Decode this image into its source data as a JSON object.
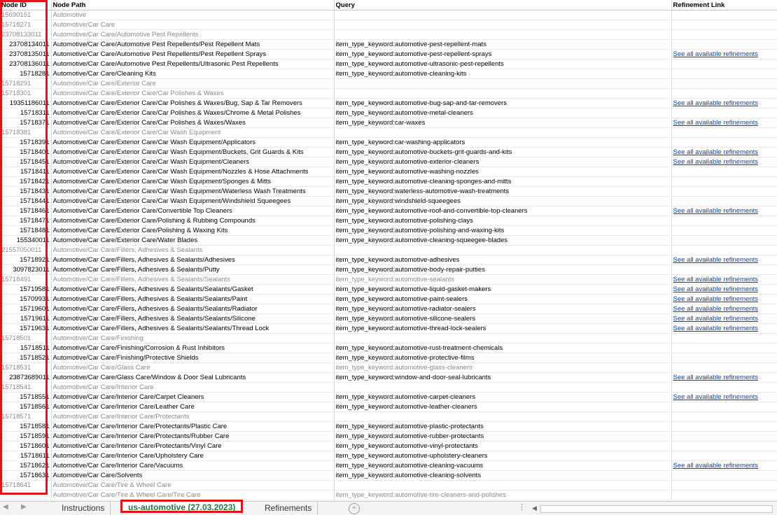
{
  "headers": [
    "Node ID",
    "Node Path",
    "Query",
    "Refinement Link"
  ],
  "rows": [
    {
      "id": "15690151",
      "path": "Automotive",
      "query": "",
      "link": "",
      "gray": true
    },
    {
      "id": "15718271",
      "path": "Automotive/Car Care",
      "query": "",
      "link": "",
      "gray": true
    },
    {
      "id": "23708133011",
      "path": "Automotive/Car Care/Automotive Pest Repellents",
      "query": "",
      "link": "",
      "gray": true
    },
    {
      "id": "23708134011",
      "path": "Automotive/Car Care/Automotive Pest Repellents/Pest Repellent Mats",
      "query": "item_type_keyword:automotive-pest-repellent-mats",
      "link": "",
      "gray": false
    },
    {
      "id": "23708135011",
      "path": "Automotive/Car Care/Automotive Pest Repellents/Pest Repellent Sprays",
      "query": "item_type_keyword:automotive-pest-repellent-sprays",
      "link": "See all available refinements",
      "gray": false
    },
    {
      "id": "23708136011",
      "path": "Automotive/Car Care/Automotive Pest Repellents/Ultrasonic Pest Repellents",
      "query": "item_type_keyword:automotive-ultrasonic-pest-repellents",
      "link": "",
      "gray": false
    },
    {
      "id": "15718281",
      "path": "Automotive/Car Care/Cleaning Kits",
      "query": "item_type_keyword:automotive-cleaning-kits",
      "link": "",
      "gray": false
    },
    {
      "id": "15718291",
      "path": "Automotive/Car Care/Exterior Care",
      "query": "",
      "link": "",
      "gray": true
    },
    {
      "id": "15718301",
      "path": "Automotive/Car Care/Exterior Care/Car Polishes & Waxes",
      "query": "",
      "link": "",
      "gray": true
    },
    {
      "id": "19351186011",
      "path": "Automotive/Car Care/Exterior Care/Car Polishes & Waxes/Bug, Sap & Tar Removers",
      "query": "item_type_keyword:automotive-bug-sap-and-tar-removers",
      "link": "See all available refinements",
      "gray": false
    },
    {
      "id": "15718311",
      "path": "Automotive/Car Care/Exterior Care/Car Polishes & Waxes/Chrome & Metal Polishes",
      "query": "item_type_keyword:automotive-metal-cleaners",
      "link": "",
      "gray": false
    },
    {
      "id": "15718371",
      "path": "Automotive/Car Care/Exterior Care/Car Polishes & Waxes/Waxes",
      "query": "item_type_keyword:car-waxes",
      "link": "See all available refinements",
      "gray": false
    },
    {
      "id": "15718381",
      "path": "Automotive/Car Care/Exterior Care/Car Wash Equipment",
      "query": "",
      "link": "",
      "gray": true
    },
    {
      "id": "15718391",
      "path": "Automotive/Car Care/Exterior Care/Car Wash Equipment/Applicators",
      "query": "item_type_keyword:car-washing-applicators",
      "link": "",
      "gray": false
    },
    {
      "id": "15718401",
      "path": "Automotive/Car Care/Exterior Care/Car Wash Equipment/Buckets, Grit Guards & Kits",
      "query": "item_type_keyword:automotive-buckets-grit-guards-and-kits",
      "link": "See all available refinements",
      "gray": false
    },
    {
      "id": "15718451",
      "path": "Automotive/Car Care/Exterior Care/Car Wash Equipment/Cleaners",
      "query": "item_type_keyword:automotive-exterior-cleaners",
      "link": "See all available refinements",
      "gray": false
    },
    {
      "id": "15718411",
      "path": "Automotive/Car Care/Exterior Care/Car Wash Equipment/Nozzles & Hose Attachments",
      "query": "item_type_keyword:automotive-washing-nozzles",
      "link": "",
      "gray": false
    },
    {
      "id": "15718421",
      "path": "Automotive/Car Care/Exterior Care/Car Wash Equipment/Sponges & Mitts",
      "query": "item_type_keyword:automotive-cleaning-sponges-and-mitts",
      "link": "",
      "gray": false
    },
    {
      "id": "15718431",
      "path": "Automotive/Car Care/Exterior Care/Car Wash Equipment/Waterless Wash Treatments",
      "query": "item_type_keyword:waterless-automotive-wash-treatments",
      "link": "",
      "gray": false
    },
    {
      "id": "15718441",
      "path": "Automotive/Car Care/Exterior Care/Car Wash Equipment/Windshield Squeegees",
      "query": "item_type_keyword:windshield-squeegees",
      "link": "",
      "gray": false
    },
    {
      "id": "15718461",
      "path": "Automotive/Car Care/Exterior Care/Convertible Top Cleaners",
      "query": "item_type_keyword:automotive-roof-and-convertible-top-cleaners",
      "link": "See all available refinements",
      "gray": false
    },
    {
      "id": "15718471",
      "path": "Automotive/Car Care/Exterior Care/Polishing & Rubbing Compounds",
      "query": "item_type_keyword:automotive-polishing-clays",
      "link": "",
      "gray": false
    },
    {
      "id": "15718481",
      "path": "Automotive/Car Care/Exterior Care/Polishing & Waxing Kits",
      "query": "item_type_keyword:automotive-polishing-and-waxing-kits",
      "link": "",
      "gray": false
    },
    {
      "id": "155340011",
      "path": "Automotive/Car Care/Exterior Care/Water Blades",
      "query": "item_type_keyword:automotive-cleaning-squeegee-blades",
      "link": "",
      "gray": false
    },
    {
      "id": "21557050011",
      "path": "Automotive/Car Care/Fillers, Adhesives & Sealants",
      "query": "",
      "link": "",
      "gray": true
    },
    {
      "id": "15718921",
      "path": "Automotive/Car Care/Fillers, Adhesives & Sealants/Adhesives",
      "query": "item_type_keyword:automotive-adhesives",
      "link": "See all available refinements",
      "gray": false
    },
    {
      "id": "3097823011",
      "path": "Automotive/Car Care/Fillers, Adhesives & Sealants/Putty",
      "query": "item_type_keyword:automotive-body-repair-putties",
      "link": "",
      "gray": false
    },
    {
      "id": "15718491",
      "path": "Automotive/Car Care/Fillers, Adhesives & Sealants/Sealants",
      "query": "item_type_keyword:automotive-sealants",
      "link": "See all available refinements",
      "gray": true
    },
    {
      "id": "15719581",
      "path": "Automotive/Car Care/Fillers, Adhesives & Sealants/Sealants/Gasket",
      "query": "item_type_keyword:automotive-liquid-gasket-makers",
      "link": "See all available refinements",
      "gray": false
    },
    {
      "id": "15709931",
      "path": "Automotive/Car Care/Fillers, Adhesives & Sealants/Sealants/Paint",
      "query": "item_type_keyword:automotive-paint-sealers",
      "link": "See all available refinements",
      "gray": false
    },
    {
      "id": "15719601",
      "path": "Automotive/Car Care/Fillers, Adhesives & Sealants/Sealants/Radiator",
      "query": "item_type_keyword:automotive-radiator-sealers",
      "link": "See all available refinements",
      "gray": false
    },
    {
      "id": "15719611",
      "path": "Automotive/Car Care/Fillers, Adhesives & Sealants/Sealants/Silicone",
      "query": "item_type_keyword:automotive-silicone-sealers",
      "link": "See all available refinements",
      "gray": false
    },
    {
      "id": "15719631",
      "path": "Automotive/Car Care/Fillers, Adhesives & Sealants/Sealants/Thread Lock",
      "query": "item_type_keyword:automotive-thread-lock-sealers",
      "link": "See all available refinements",
      "gray": false
    },
    {
      "id": "15718501",
      "path": "Automotive/Car Care/Finishing",
      "query": "",
      "link": "",
      "gray": true
    },
    {
      "id": "15718511",
      "path": "Automotive/Car Care/Finishing/Corrosion & Rust Inhibitors",
      "query": "item_type_keyword:automotive-rust-treatment-chemicals",
      "link": "",
      "gray": false
    },
    {
      "id": "15718521",
      "path": "Automotive/Car Care/Finishing/Protective Shields",
      "query": "item_type_keyword:automotive-protective-films",
      "link": "",
      "gray": false
    },
    {
      "id": "15718531",
      "path": "Automotive/Car Care/Glass Care",
      "query": "item_type_keyword:automotive-glass-cleaners",
      "link": "",
      "gray": true
    },
    {
      "id": "23873689011",
      "path": "Automotive/Car Care/Glass Care/Window & Door Seal Lubricants",
      "query": "item_type_keyword:window-and-door-seal-lubricants",
      "link": "See all available refinements",
      "gray": false
    },
    {
      "id": "15718541",
      "path": "Automotive/Car Care/Interior Care",
      "query": "",
      "link": "",
      "gray": true
    },
    {
      "id": "15718551",
      "path": "Automotive/Car Care/Interior Care/Carpet Cleaners",
      "query": "item_type_keyword:automotive-carpet-cleaners",
      "link": "See all available refinements",
      "gray": false
    },
    {
      "id": "15718561",
      "path": "Automotive/Car Care/Interior Care/Leather Care",
      "query": "item_type_keyword:automotive-leather-cleaners",
      "link": "",
      "gray": false
    },
    {
      "id": "15718571",
      "path": "Automotive/Car Care/Interior Care/Protectants",
      "query": "",
      "link": "",
      "gray": true
    },
    {
      "id": "15718581",
      "path": "Automotive/Car Care/Interior Care/Protectants/Plastic Care",
      "query": "item_type_keyword:automotive-plastic-protectants",
      "link": "",
      "gray": false
    },
    {
      "id": "15718591",
      "path": "Automotive/Car Care/Interior Care/Protectants/Rubber Care",
      "query": "item_type_keyword:automotive-rubber-protectants",
      "link": "",
      "gray": false
    },
    {
      "id": "15718601",
      "path": "Automotive/Car Care/Interior Care/Protectants/Vinyl Care",
      "query": "item_type_keyword:automotive-vinyl-protectants",
      "link": "",
      "gray": false
    },
    {
      "id": "15718611",
      "path": "Automotive/Car Care/Interior Care/Upholstery Care",
      "query": "item_type_keyword:automotive-upholstery-cleaners",
      "link": "",
      "gray": false
    },
    {
      "id": "15718621",
      "path": "Automotive/Car Care/Interior Care/Vacuums",
      "query": "item_type_keyword:automotive-cleaning-vacuums",
      "link": "See all available refinements",
      "gray": false
    },
    {
      "id": "15718631",
      "path": "Automotive/Car Care/Solvents",
      "query": "item_type_keyword:automotive-cleaning-solvents",
      "link": "",
      "gray": false
    },
    {
      "id": "15718641",
      "path": "Automotive/Car Care/Tire & Wheel Care",
      "query": "",
      "link": "",
      "gray": true
    },
    {
      "id": "",
      "path": "Automotive/Car Care/Tire & Wheel Care/Tire Care",
      "query": "item_type_keyword:automotive-tire-cleaners-and-polishes",
      "link": "",
      "gray": true
    }
  ],
  "tabs": {
    "instructions": "Instructions",
    "active": "us-automotive (27.03.2023)",
    "refinements": "Refinements",
    "add_symbol": "+",
    "more_symbol": "⋮"
  },
  "colors": {
    "highlight": "#e3121b",
    "active_tab_text": "#1a7a3c",
    "link": "#0645ad"
  }
}
